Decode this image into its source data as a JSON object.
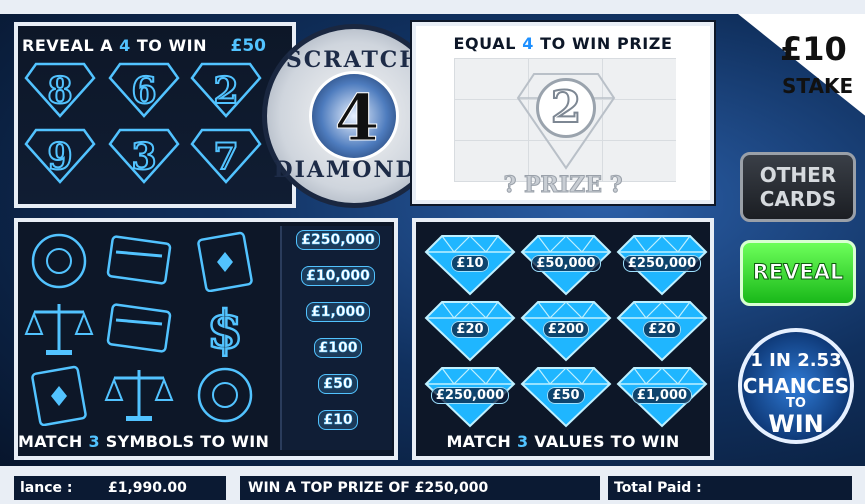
{
  "top_left": {
    "header_prefix": "REVEAL A ",
    "header_number": "4",
    "header_suffix": " TO WIN",
    "prize": "£50",
    "numbers": [
      "8",
      "6",
      "2",
      "9",
      "3",
      "7"
    ]
  },
  "logo": {
    "word_top": "SCRATCH",
    "number": "4",
    "word_bottom": "DIAMONDS"
  },
  "top_right": {
    "header_prefix": "EQUAL ",
    "header_number": "4",
    "header_suffix": " TO WIN PRIZE",
    "revealed_number": "2",
    "prize_label": "? PRIZE ?"
  },
  "side": {
    "stake_amount": "£10",
    "stake_label": "STAKE",
    "other_cards_line1": "OTHER",
    "other_cards_line2": "CARDS",
    "reveal_label": "REVEAL",
    "chances_l1": "1 IN 2.53",
    "chances_l2": "CHANCES",
    "chances_l3": "TO",
    "chances_l4": "WIN"
  },
  "bottom_left": {
    "symbols": [
      "ring-icon",
      "card-icon",
      "ace-icon",
      "scales-icon",
      "card-icon",
      "dollar-icon",
      "ace-icon",
      "scales-icon",
      "ring-icon"
    ],
    "prizes": [
      "£250,000",
      "£10,000",
      "£1,000",
      "£100",
      "£50",
      "£10"
    ],
    "footer_prefix": "MATCH ",
    "footer_number": "3",
    "footer_suffix": " SYMBOLS TO WIN"
  },
  "bottom_right": {
    "values": [
      "£10",
      "£50,000",
      "£250,000",
      "£20",
      "£200",
      "£20",
      "£250,000",
      "£50",
      "£1,000"
    ],
    "footer_prefix": "MATCH ",
    "footer_number": "3",
    "footer_suffix": " VALUES TO WIN"
  },
  "status": {
    "balance_label": "lance :",
    "balance_value": "£1,990.00",
    "top_prize_text": "WIN A TOP PRIZE OF £250,000",
    "total_paid_label": "Total Paid :"
  },
  "colors": {
    "accent_blue": "#52c3ff",
    "reveal_green": "#19b819",
    "panel_dark": "#0d1728"
  }
}
